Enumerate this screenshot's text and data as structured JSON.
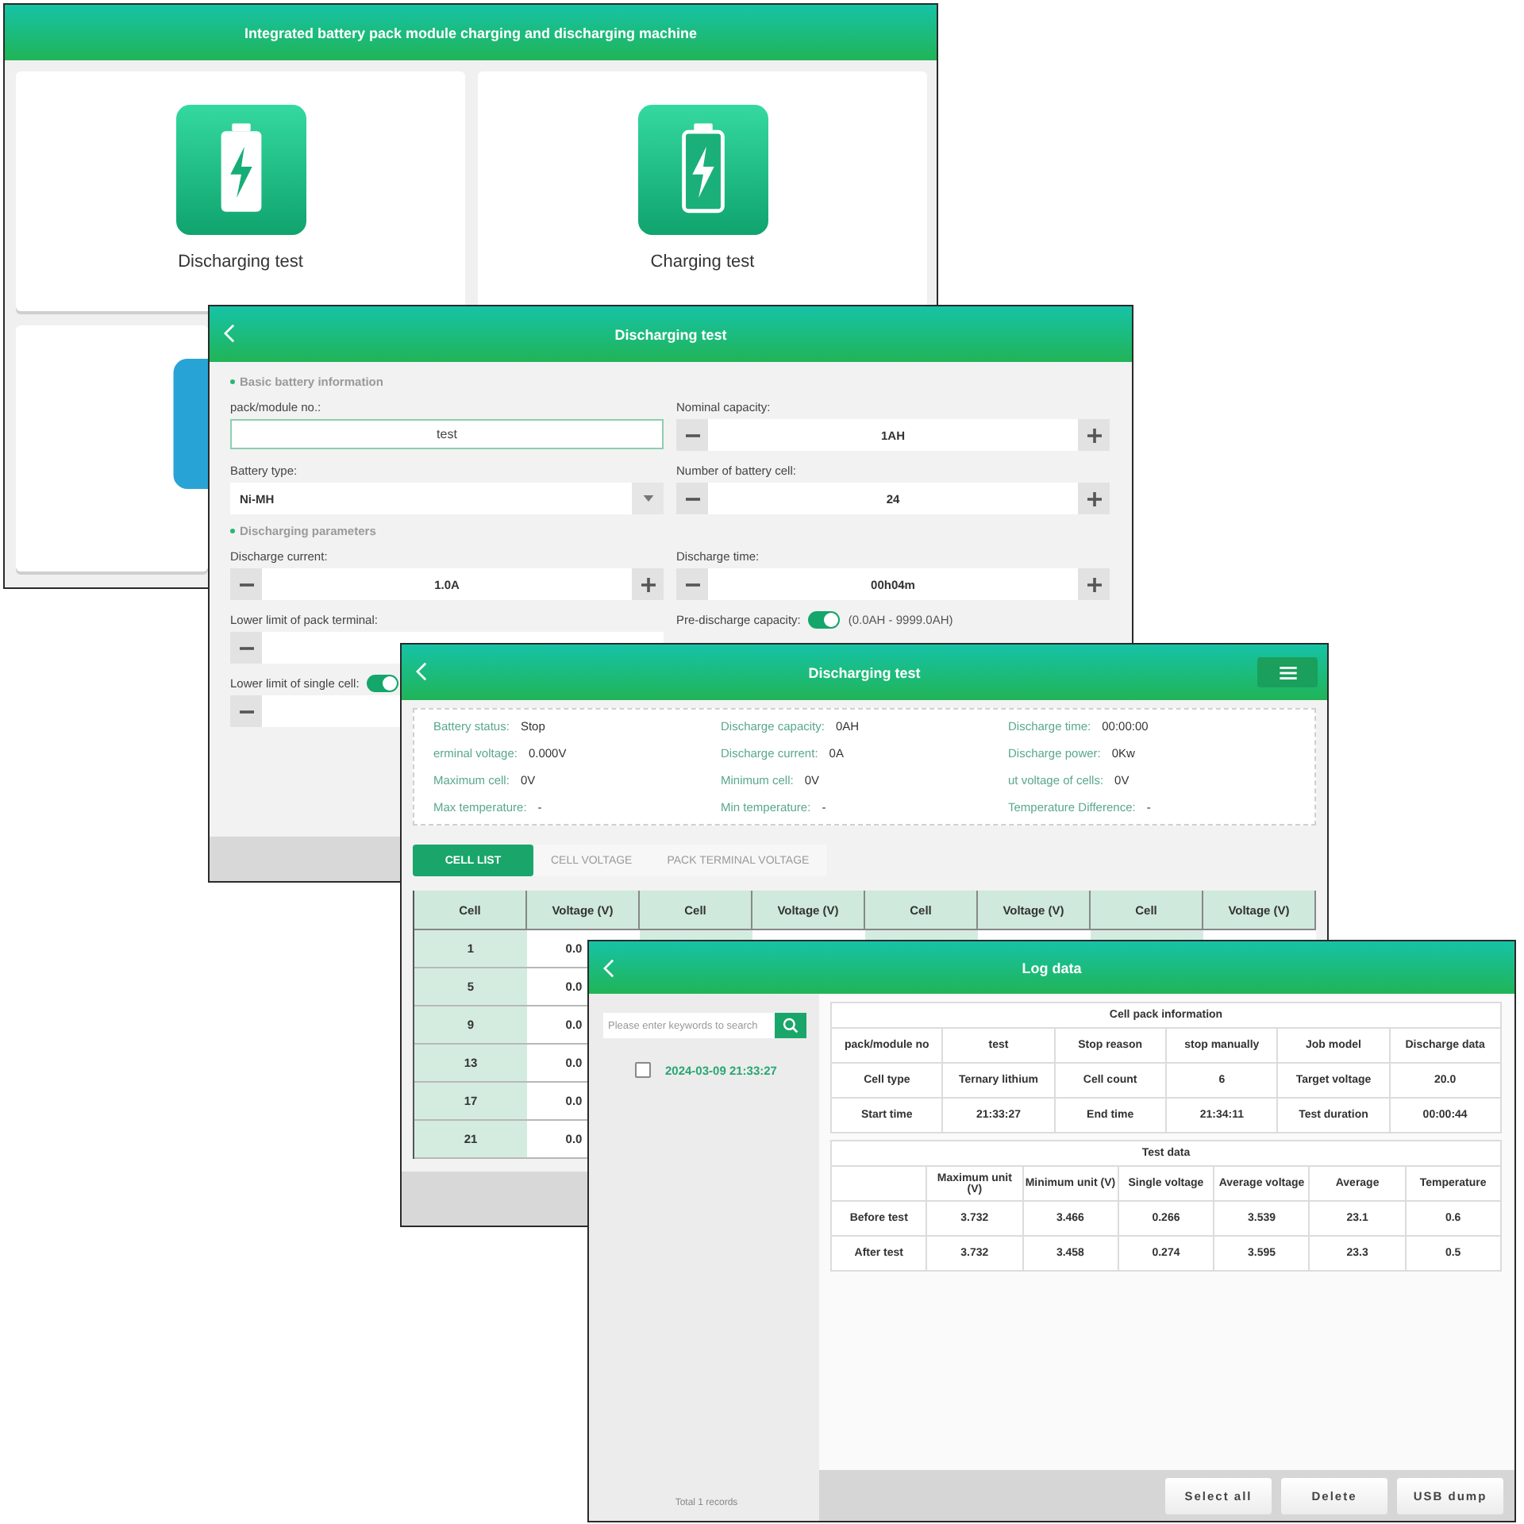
{
  "main_menu": {
    "title": "Integrated battery pack module charging and discharging machine",
    "cards": [
      {
        "kind": "discharge",
        "label": "Discharging test"
      },
      {
        "kind": "charge",
        "label": "Charging test"
      },
      {
        "kind": "other"
      }
    ]
  },
  "discharge_setup": {
    "title": "Discharging test",
    "sections": [
      {
        "heading": "Basic battery information",
        "fields": [
          {
            "kind": "text",
            "label": "pack/module no.:",
            "value": "test"
          },
          {
            "kind": "stepper",
            "label": "Nominal capacity:",
            "value": "1AH"
          },
          {
            "kind": "select",
            "label": "Battery type:",
            "value": "Ni-MH"
          },
          {
            "kind": "stepper",
            "label": "Number of battery cell:",
            "value": "24"
          }
        ]
      },
      {
        "heading": "Discharging parameters",
        "fields": [
          {
            "kind": "stepper",
            "label": "Discharge current:",
            "value": "1.0A"
          },
          {
            "kind": "stepper",
            "label": "Discharge time:",
            "value": "00h04m"
          },
          {
            "kind": "stepper",
            "label": "Lower limit of pack terminal:"
          },
          {
            "kind": "switch",
            "label": "Pre-discharge capacity:",
            "on": true,
            "range": "(0.0AH - 9999.0AH)"
          },
          {
            "kind": "stepper",
            "label": "Lower limit of single cell:",
            "on": true
          }
        ]
      }
    ]
  },
  "discharge_monitor": {
    "title": "Discharging test",
    "info": [
      {
        "label": "Battery status:",
        "value": "Stop"
      },
      {
        "label": "Discharge capacity:",
        "value": "0AH"
      },
      {
        "label": "Discharge time:",
        "value": "00:00:00"
      },
      {
        "label": "erminal voltage:",
        "value": "0.000V"
      },
      {
        "label": "Discharge current:",
        "value": "0A"
      },
      {
        "label": "Discharge power:",
        "value": "0Kw"
      },
      {
        "label": "Maximum cell:",
        "value": "0V"
      },
      {
        "label": "Minimum cell:",
        "value": "0V"
      },
      {
        "label": "ut voltage of cells:",
        "value": "0V"
      },
      {
        "label": "Max temperature:",
        "value": "-"
      },
      {
        "label": "Min temperature:",
        "value": "-"
      },
      {
        "label": "Temperature Difference:",
        "value": "-"
      }
    ],
    "tabs": [
      {
        "label": "CELL LIST",
        "selected": true
      },
      {
        "label": "CELL VOLTAGE",
        "selected": false
      },
      {
        "label": "PACK TERMINAL VOLTAGE",
        "selected": false
      }
    ],
    "table": {
      "columns": [
        "Cell",
        "Voltage (V)",
        "Cell",
        "Voltage (V)",
        "Cell",
        "Voltage (V)",
        "Cell",
        "Voltage (V)"
      ],
      "rows": [
        [
          "1",
          "0.0"
        ],
        [
          "5",
          "0.0"
        ],
        [
          "9",
          "0.0"
        ],
        [
          "13",
          "0.0"
        ],
        [
          "17",
          "0.0"
        ],
        [
          "21",
          "0.0"
        ]
      ]
    }
  },
  "log_data": {
    "title": "Log data",
    "search": {
      "placeholder": "Please enter keywords to search"
    },
    "records": [
      {
        "label": "2024-03-09 21:33:27",
        "checked": false
      }
    ],
    "total": "Total 1 records",
    "pack_info": {
      "title": "Cell pack information",
      "rows": [
        [
          "pack/module no",
          "test",
          "Stop reason",
          "stop manually",
          "Job model",
          "Discharge data"
        ],
        [
          "Cell type",
          "Ternary lithium",
          "Cell count",
          "6",
          "Target voltage",
          "20.0"
        ],
        [
          "Start time",
          "21:33:27",
          "End time",
          "21:34:11",
          "Test duration",
          "00:00:44"
        ]
      ]
    },
    "test_data": {
      "title": "Test data",
      "columns": [
        "Maximum unit (V)",
        "Minimum unit (V)",
        "Single voltage",
        "Average voltage",
        "Average",
        "Temperature"
      ],
      "rows": [
        {
          "label": "Before test",
          "values": [
            "3.732",
            "3.466",
            "0.266",
            "3.539",
            "23.1",
            "0.6"
          ]
        },
        {
          "label": "After test",
          "values": [
            "3.732",
            "3.458",
            "0.274",
            "3.595",
            "23.3",
            "0.5"
          ]
        }
      ]
    },
    "buttons": [
      "Select all",
      "Delete",
      "USB dump"
    ]
  }
}
